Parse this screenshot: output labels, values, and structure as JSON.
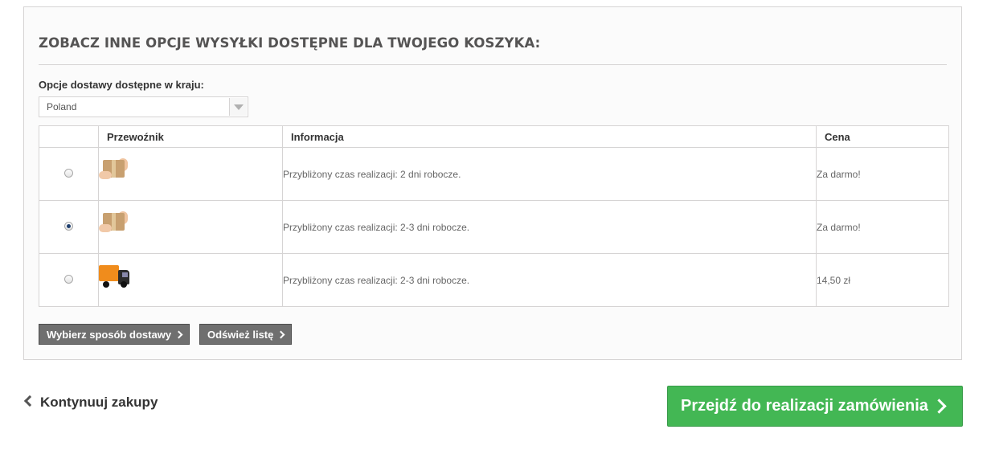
{
  "shipping": {
    "title": "ZOBACZ INNE OPCJE WYSYŁKI DOSTĘPNE DLA TWOJEGO KOSZYKA:",
    "country_label": "Opcje dostawy dostępne w kraju:",
    "country_value": "Poland",
    "table": {
      "headers": [
        "",
        "Przewoźnik",
        "Informacja",
        "Cena"
      ],
      "rows": [
        {
          "logo_icon": "package-in-hands-icon",
          "selected": false,
          "info": "Przybliżony czas realizacji: 2 dni robocze.",
          "price": "Za darmo!"
        },
        {
          "logo_icon": "package-in-hands-icon",
          "selected": true,
          "info": "Przybliżony czas realizacji: 2-3 dni robocze.",
          "price": "Za darmo!"
        },
        {
          "logo_icon": "truck-icon",
          "selected": false,
          "info": "Przybliżony czas realizacji: 2-3 dni robocze.",
          "price": "14,50 zł"
        }
      ]
    },
    "choose_button": "Wybierz sposób dostawy",
    "refresh_button": "Odśwież listę"
  },
  "continue_shopping": "Kontynuuj zakupy",
  "checkout_button": "Przejdź do realizacji zamówienia",
  "colors": {
    "checkout": "#43b754",
    "dark_button": "#6f6f6f"
  }
}
